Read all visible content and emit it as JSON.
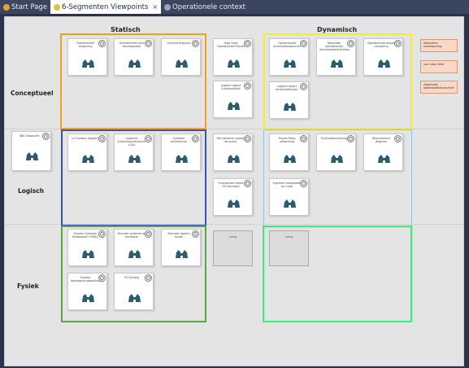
{
  "tabs": [
    {
      "label": "Start Page",
      "active": false,
      "icon": "start-page-icon",
      "icon_color": "#f0a030"
    },
    {
      "label": "6-Segmenten Viewpoints",
      "active": true,
      "icon": "diagram-icon",
      "icon_color": "#e8c040",
      "close": "×"
    },
    {
      "label": "Operationele context",
      "active": false,
      "icon": "diagram-icon",
      "icon_color": "#9aa4b8"
    }
  ],
  "columns": {
    "statisch": "Statisch",
    "dynamisch": "Dynamisch"
  },
  "rows": {
    "conceptueel": "Conceptueel",
    "logisch": "Logisch",
    "fysiek": "Fysiek"
  },
  "nodes": [
    {
      "label": "Operationele omgeving"
    },
    {
      "label": "Operationele taak decompositie"
    },
    {
      "label": "Context diagram"
    },
    {
      "label": "High level Operationeel Proces"
    },
    {
      "label": "Operationele omschakelspaneren"
    },
    {
      "label": "Realisatie operationele omschakelactiviteiten"
    },
    {
      "label": "Operationele proces uitvoering"
    },
    {
      "label": "Logisch object functionaliteit"
    },
    {
      "label": "Logisch object omschakelingen"
    },
    {
      "label": "SBS Viewpoint"
    },
    {
      "label": "LV Context diagram"
    },
    {
      "label": "Logische Systeemarchitectuur (LSA)"
    },
    {
      "label": "Systeem architectuur"
    },
    {
      "label": "Het generiek gedrag structuur"
    },
    {
      "label": "Proces flows uitwerking"
    },
    {
      "label": "Functiebeschrijving"
    },
    {
      "label": "Requirement diagram"
    },
    {
      "label": "Functioneel detail (FS-formaat)"
    },
    {
      "label": "Systeem toestanden en modi"
    },
    {
      "label": "Fysieke Systeem Breakdown (FSBD)"
    },
    {
      "label": "Discrete software op hardware"
    },
    {
      "label": "Discrete logisch fysiek"
    },
    {
      "label": "Fysieke Naamgevingsbeslissing"
    },
    {
      "label": "FS Context"
    }
  ],
  "placeholders": [
    "Leeg",
    "Leeg"
  ],
  "notes": [
    "Afspraken naamgeving",
    "use case view",
    "Algemeen stakeholderoverzicht"
  ],
  "colors": {
    "orange": "#f0a020",
    "yellow": "#f3ea3a",
    "blue": "#3d4fb8",
    "lightblue": "#8cc4ec",
    "green": "#5aa54a",
    "brightgreen": "#3dea7c"
  }
}
